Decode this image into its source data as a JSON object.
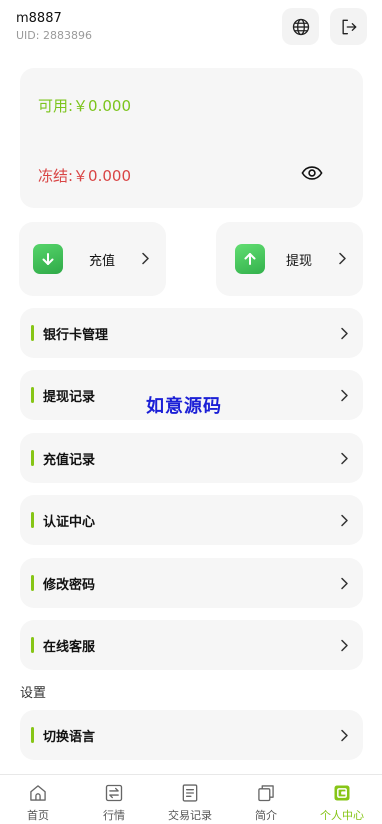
{
  "header": {
    "username": "m8887",
    "uid": "UID: 2883896"
  },
  "wallet": {
    "available": "可用:￥0.000",
    "frozen": "冻结:￥0.000"
  },
  "actions": {
    "deposit": "充值",
    "withdraw": "提现"
  },
  "menu": [
    {
      "label": "银行卡管理"
    },
    {
      "label": "提现记录"
    },
    {
      "label": "充值记录"
    },
    {
      "label": "认证中心"
    },
    {
      "label": "修改密码"
    },
    {
      "label": "在线客服"
    }
  ],
  "settings": {
    "section_label": "设置",
    "language": "切换语言"
  },
  "watermark": "如意源码",
  "tabs": [
    {
      "label": "首页",
      "icon": "home-icon"
    },
    {
      "label": "行情",
      "icon": "exchange-icon"
    },
    {
      "label": "交易记录",
      "icon": "document-icon"
    },
    {
      "label": "简介",
      "icon": "copy-icon"
    },
    {
      "label": "个人中心",
      "icon": "wallet-icon"
    }
  ],
  "colors": {
    "accent": "#86c516",
    "available": "#7cc41c",
    "frozen": "#d94545",
    "watermark": "#1b1fd6"
  }
}
